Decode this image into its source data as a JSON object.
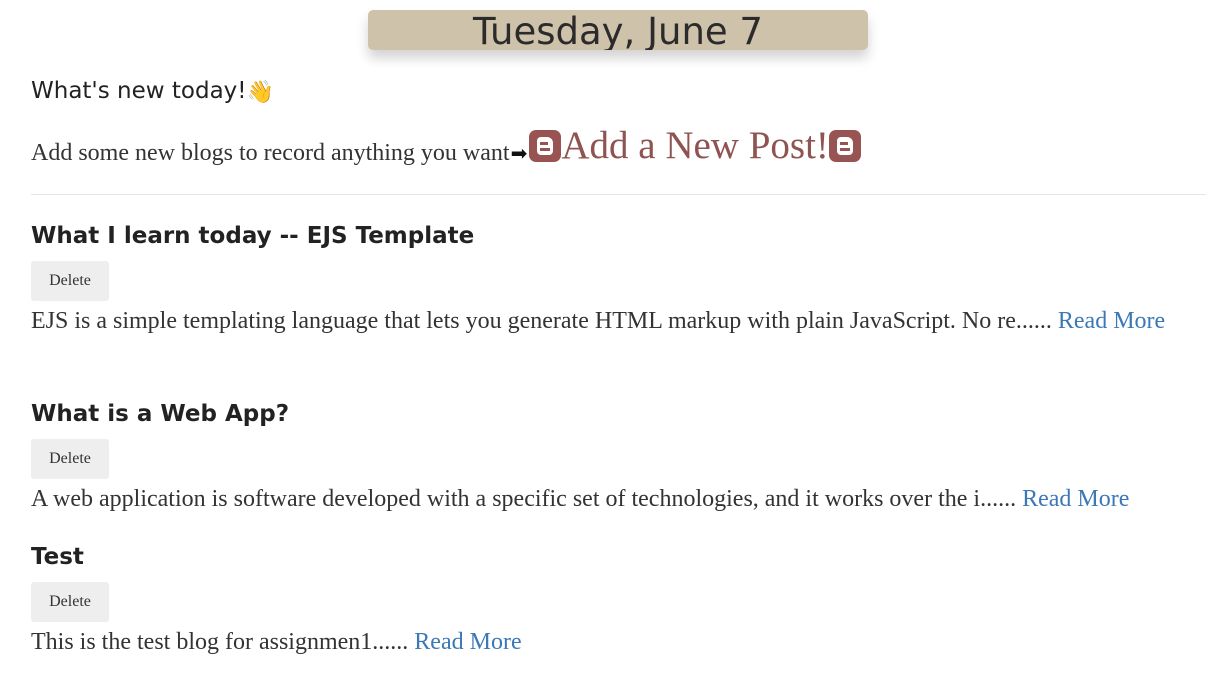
{
  "header": {
    "date": "Tuesday, June 7"
  },
  "welcome": {
    "heading": "What's new today!",
    "wave_icon": "👋",
    "intro_text": "Add some new blogs to record anything you want",
    "arrow_icon": "➡",
    "add_post_label": "Add a New Post!",
    "blogger_icon": "blogger-icon"
  },
  "colors": {
    "banner_bg": "#cfc2ab",
    "add_post": "#8f5452",
    "link": "#3a78b7",
    "delete_bg": "#eeeeee"
  },
  "posts": [
    {
      "title": "What I learn today -- EJS Template",
      "delete_label": "Delete",
      "excerpt": "EJS is a simple templating language that lets you generate HTML markup with plain JavaScript. No re......",
      "read_more": "Read More"
    },
    {
      "title": "What is a Web App?",
      "delete_label": "Delete",
      "excerpt": "A web application is software developed with a specific set of technologies, and it works over the i......",
      "read_more": "Read More"
    },
    {
      "title": "Test",
      "delete_label": "Delete",
      "excerpt": "This is the test blog for assignmen1......",
      "read_more": "Read More"
    }
  ]
}
